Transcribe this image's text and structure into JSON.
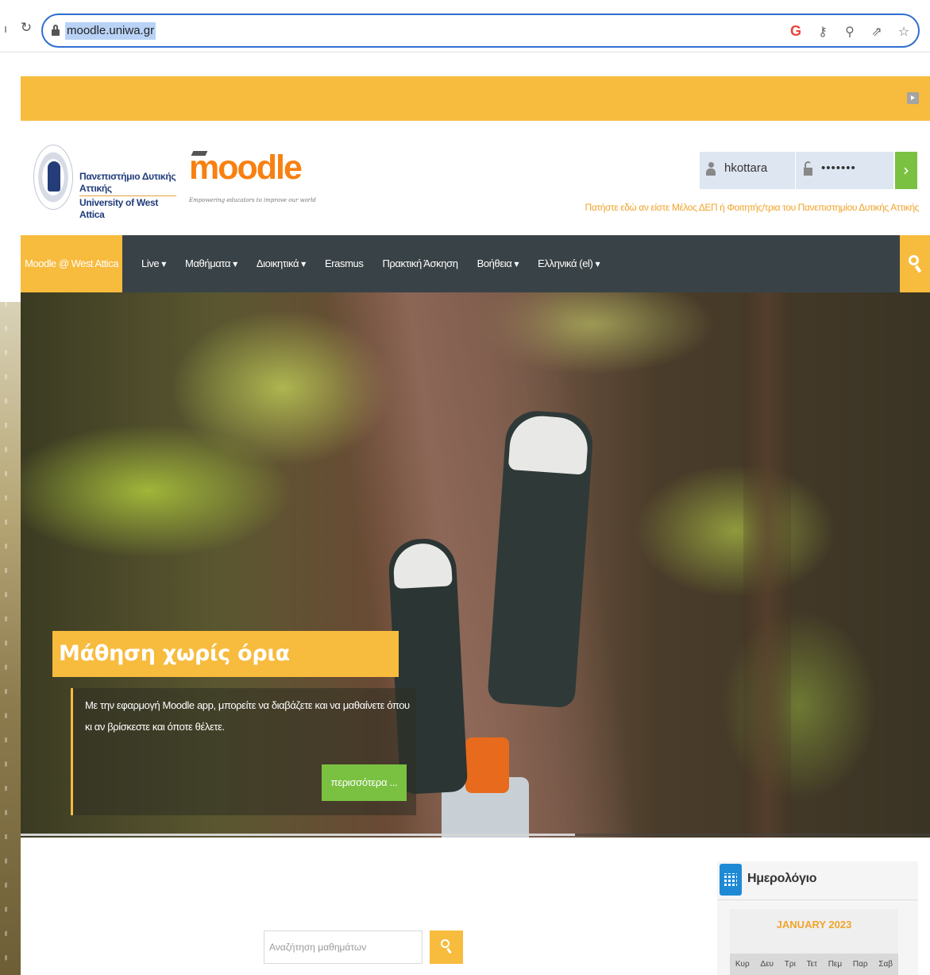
{
  "browser": {
    "url": "moodle.uniwa.gr"
  },
  "header": {
    "university_line1": "Πανεπιστήμιο Δυτικής Αττικής",
    "university_line2": "University of West Attica",
    "moodle_word": "moodle",
    "moodle_tagline": "Empowering educators to improve our world",
    "login": {
      "username": "hkottara",
      "password_masked": "•••••••",
      "submit_icon": "chevron-right",
      "hint": "Πατήστε εδώ αν είστε Μέλος ΔΕΠ ή Φοιτητής/τρια του Πανεπιστημίου Δυτικής Αττικής"
    }
  },
  "nav": {
    "home": "Moodle @ West Attica",
    "items": [
      {
        "label": "Live",
        "dropdown": true
      },
      {
        "label": "Μαθήματα",
        "dropdown": true
      },
      {
        "label": "Διοικητικά",
        "dropdown": true
      },
      {
        "label": "Erasmus",
        "dropdown": false
      },
      {
        "label": "Πρακτική Άσκηση",
        "dropdown": false
      },
      {
        "label": "Βοήθεια",
        "dropdown": true
      },
      {
        "label": "Ελληνικά (el)",
        "dropdown": true
      }
    ]
  },
  "hero": {
    "title": "Μάθηση χωρίς όρια",
    "caption": "Με την εφαρμογή Moodle app, μπορείτε να διαβάζετε και να μαθαίνετε όπου κι αν βρίσκεστε και όποτε θέλετε.",
    "more_button": "περισσότερα ...",
    "progress": 0.61
  },
  "course_search": {
    "placeholder": "Αναζήτηση μαθημάτων"
  },
  "calendar": {
    "title": "Ημερολόγιο",
    "month": "JANUARY 2023",
    "weekdays": [
      "Κυρ",
      "Δευ",
      "Τρι",
      "Τετ",
      "Πεμ",
      "Παρ",
      "Σαβ"
    ]
  },
  "colors": {
    "accent_yellow": "#f7bb3d",
    "nav_dark": "#394347",
    "go_green": "#7ac142",
    "moodle_orange": "#f88012",
    "calendar_blue": "#1e8ad6"
  }
}
